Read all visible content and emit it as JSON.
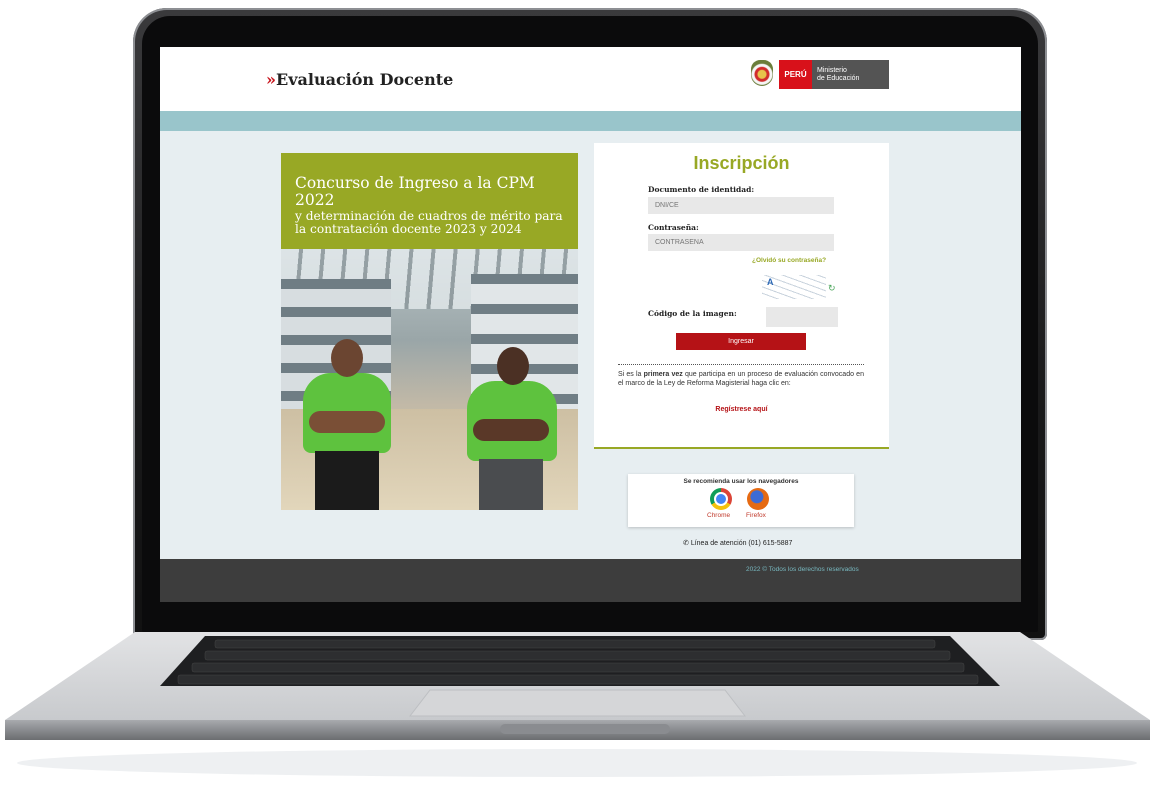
{
  "header": {
    "brand_mark": "»",
    "brand_title": "Evaluación Docente",
    "logo": {
      "country": "PERÚ",
      "ministry_line1": "Ministerio",
      "ministry_line2": "de Educación"
    }
  },
  "banner": {
    "title": "Concurso de Ingreso a la CPM 2022",
    "subtitle": "y determinación de cuadros de mérito para la contratación docente 2023 y 2024"
  },
  "form": {
    "title": "Inscripción",
    "document_label": "Documento de identidad:",
    "document_placeholder": "DNI/CE",
    "password_label": "Contraseña:",
    "password_placeholder": "CONTRASEÑA",
    "forgot_link": "¿Olvidó su contraseña?",
    "captcha_char": "A",
    "captcha_label": "Código de la imagen:",
    "submit": "Ingresar",
    "info_prefix": "Si es la",
    "info_bold": "primera vez",
    "info_suffix": "que participa en un proceso de evaluación convocado en el marco de la Ley de Reforma Magisterial haga clic en:",
    "register_link": "Regístrese aquí"
  },
  "browsers": {
    "title": "Se recomienda usar los navegadores",
    "items": [
      "Chrome",
      "Firefox"
    ]
  },
  "support": {
    "phone": "Línea de atención (01) 615-5887"
  },
  "footer": {
    "copyright": "2022 © Todos los derechos reservados"
  },
  "colors": {
    "accent_green": "#98a825",
    "brand_red": "#b51216",
    "teal": "#99c5cb"
  }
}
